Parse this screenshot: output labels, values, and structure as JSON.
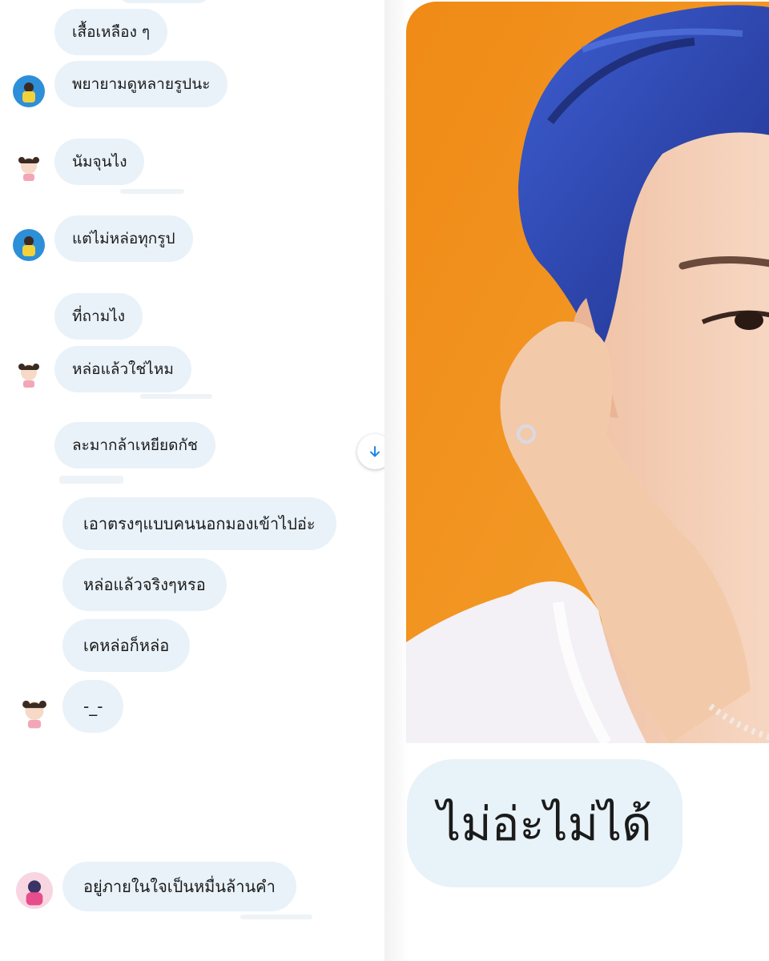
{
  "chat": {
    "messages": [
      {
        "text": "เสื้อเหลือง ๆ",
        "sender": "friend"
      },
      {
        "text": "พยายามดูหลายรูปนะ",
        "sender": "friend"
      },
      {
        "text": "นัมจุนไง",
        "sender": "me"
      },
      {
        "text": "แต่ไม่หล่อทุกรูป",
        "sender": "friend"
      },
      {
        "text": "ที่ถามไง",
        "sender": "friend"
      },
      {
        "text": "หล่อแล้วใช่ไหม",
        "sender": "me"
      },
      {
        "text": "ละมากล้าเหยียดกัช",
        "sender": "me"
      },
      {
        "text": "เอาตรงๆแบบคนนอกมองเข้าไปอ่ะ",
        "sender": "friend2"
      },
      {
        "text": "หล่อแล้วจริงๆหรอ",
        "sender": "friend2"
      },
      {
        "text": "เคหล่อก็หล่อ",
        "sender": "friend2"
      },
      {
        "text": "-_-",
        "sender": "me"
      },
      {
        "text": "อยู่ภายในใจเป็นหมื่นล้านคำ",
        "sender": "friend3"
      }
    ]
  },
  "meme": {
    "caption": "ไม่อ่ะไม่ได้"
  },
  "icons": {
    "scroll_down": "arrow-down-icon"
  },
  "colors": {
    "bubble": "#e9f2f9",
    "photo_background": "#f0921e",
    "hair": "#3b4fb8",
    "accent": "#1e88e5"
  }
}
